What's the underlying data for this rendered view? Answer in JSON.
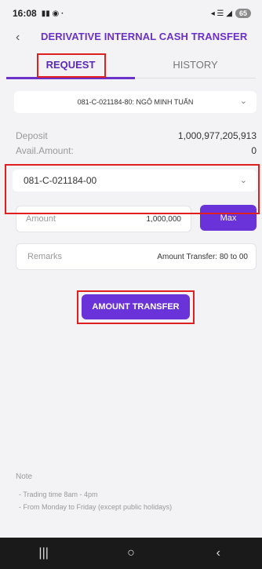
{
  "status_bar": {
    "time": "16:08",
    "battery": "65"
  },
  "header": {
    "title": "DERIVATIVE INTERNAL CASH TRANSFER"
  },
  "tabs": [
    {
      "label": "REQUEST",
      "active": true
    },
    {
      "label": "HISTORY",
      "active": false
    }
  ],
  "account_select": {
    "value": "081-C-021184-80: NGÔ MINH TUẤN"
  },
  "info": {
    "deposit_label": "Deposit",
    "deposit_value": "1,000,977,205,913",
    "avail_label": "Avail.Amount:",
    "avail_value": "0"
  },
  "sub_account_select": {
    "value": "081-C-021184-00"
  },
  "amount": {
    "label": "Amount",
    "value": "1,000,000",
    "max_label": "Max"
  },
  "remarks": {
    "label": "Remarks",
    "value": "Amount Transfer: 80 to 00"
  },
  "transfer_button": {
    "label": "AMOUNT TRANSFER"
  },
  "note": {
    "title": "Note",
    "lines": [
      "- Trading time 8am - 4pm",
      "- From Monday to Friday (except public holidays)"
    ]
  },
  "colors": {
    "accent": "#6a32d9",
    "highlight": "#e02020"
  }
}
